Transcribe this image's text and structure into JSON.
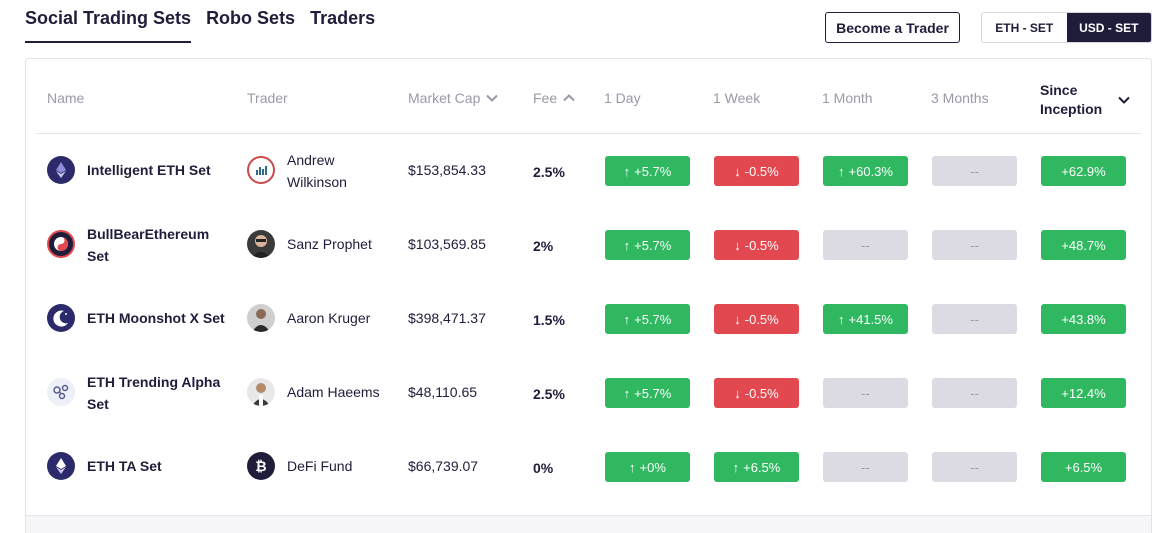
{
  "tabs": [
    {
      "label": "Social Trading Sets",
      "active": true
    },
    {
      "label": "Robo Sets",
      "active": false
    },
    {
      "label": "Traders",
      "active": false
    }
  ],
  "become_trader_label": "Become a Trader",
  "currency_toggle": {
    "eth_label": "ETH - SET",
    "usd_label": "USD - SET",
    "selected": "USD - SET"
  },
  "headers": {
    "name": "Name",
    "trader": "Trader",
    "market_cap": "Market Cap",
    "fee": "Fee",
    "day": "1 Day",
    "week": "1 Week",
    "month": "1 Month",
    "months3": "3 Months",
    "since_inception": "Since Inception"
  },
  "rows": [
    {
      "name": "Intelligent ETH Set",
      "trader": "Andrew Wilkinson",
      "market_cap": "$153,854.33",
      "fee": "2.5%",
      "day": "+5.7%",
      "week": "-0.5%",
      "month": "+60.3%",
      "months3": "--",
      "since": "+62.9%"
    },
    {
      "name": "BullBearEthereum Set",
      "trader": "Sanz Prophet",
      "market_cap": "$103,569.85",
      "fee": "2%",
      "day": "+5.7%",
      "week": "-0.5%",
      "month": "--",
      "months3": "--",
      "since": "+48.7%"
    },
    {
      "name": "ETH Moonshot X Set",
      "trader": "Aaron Kruger",
      "market_cap": "$398,471.37",
      "fee": "1.5%",
      "day": "+5.7%",
      "week": "-0.5%",
      "month": "+41.5%",
      "months3": "--",
      "since": "+43.8%"
    },
    {
      "name": "ETH Trending Alpha Set",
      "trader": "Adam Haeems",
      "market_cap": "$48,110.65",
      "fee": "2.5%",
      "day": "+5.7%",
      "week": "-0.5%",
      "month": "--",
      "months3": "--",
      "since": "+12.4%"
    },
    {
      "name": "ETH TA Set",
      "trader": "DeFi Fund",
      "market_cap": "$66,739.07",
      "fee": "0%",
      "day": "+0%",
      "week": "+6.5%",
      "month": "--",
      "months3": "--",
      "since": "+6.5%"
    }
  ],
  "colors": {
    "positive": "#30b860",
    "negative": "#e2484f",
    "empty": "#dcdbe3",
    "navy": "#1f1d3a"
  }
}
